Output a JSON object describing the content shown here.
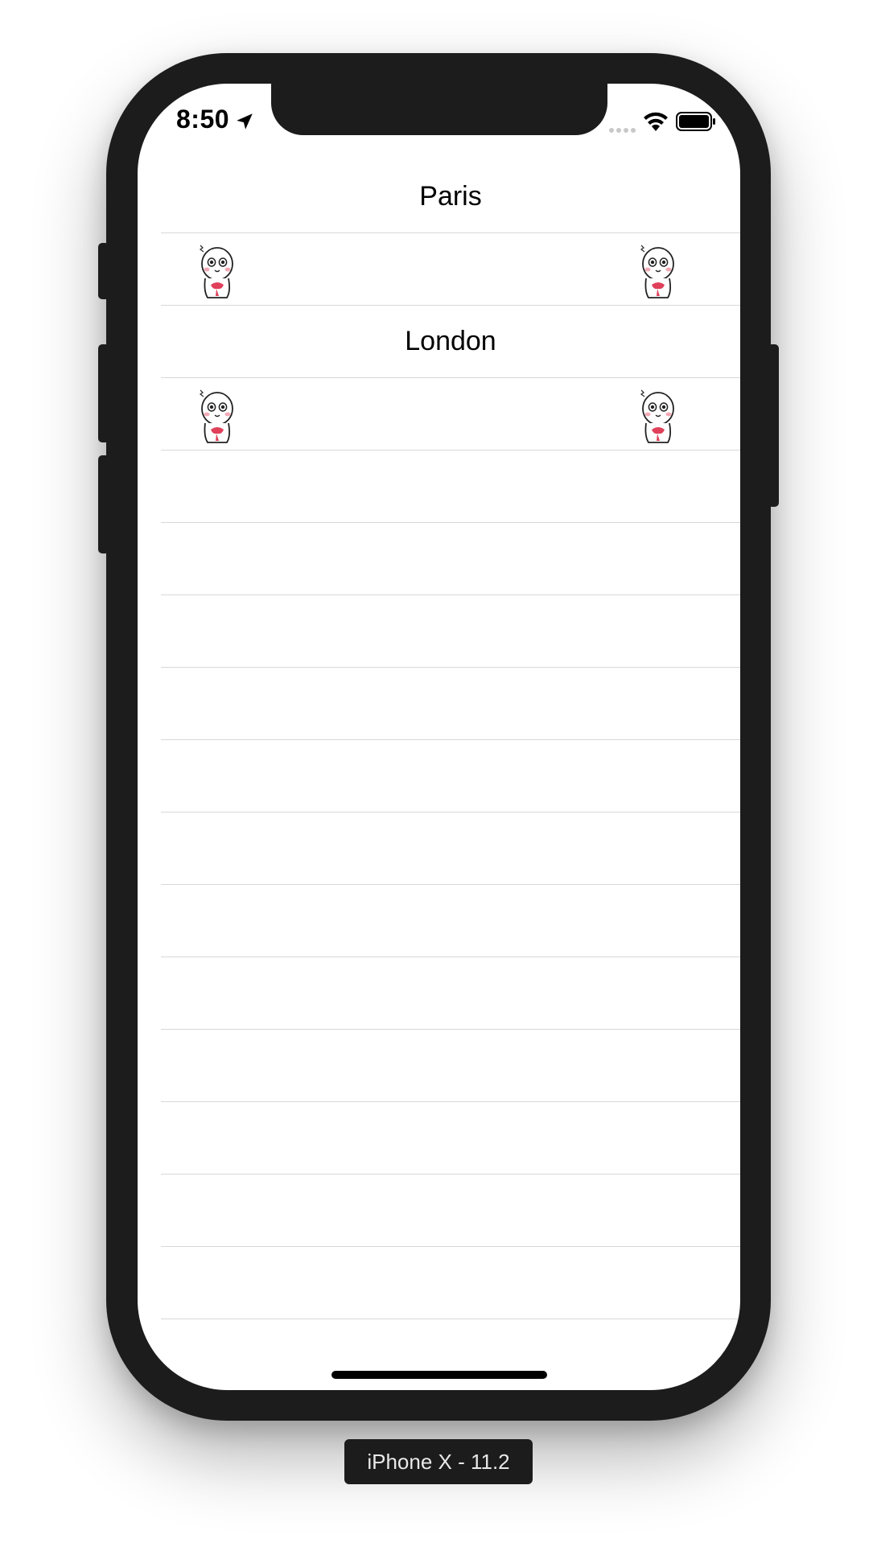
{
  "status_bar": {
    "time": "8:50",
    "icons": [
      "location-arrow-icon",
      "signal-dots-icon",
      "wifi-icon",
      "battery-icon"
    ]
  },
  "table": {
    "rows": [
      {
        "type": "header",
        "title": "Paris"
      },
      {
        "type": "stickers",
        "icons": [
          "sticker-character-icon",
          "sticker-character-icon"
        ]
      },
      {
        "type": "header",
        "title": "London"
      },
      {
        "type": "stickers",
        "icons": [
          "sticker-character-icon",
          "sticker-character-icon"
        ]
      }
    ],
    "empty_row_count": 12
  },
  "simulator": {
    "label": "iPhone X - 11.2"
  },
  "colors": {
    "device_frame": "#1c1c1c",
    "separator": "#d8d8dc",
    "sticker_accent": "#e0405a",
    "sticker_blush": "#f3a8b4"
  }
}
